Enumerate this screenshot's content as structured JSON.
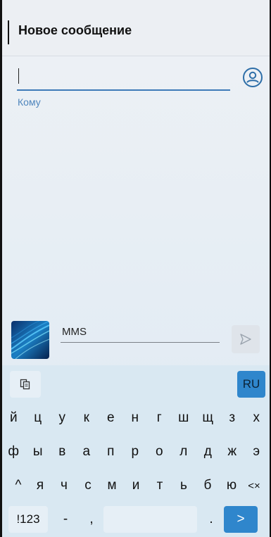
{
  "header": {
    "title": "Новое сообщение"
  },
  "recipient": {
    "label": "Кому",
    "value": ""
  },
  "compose": {
    "placeholder": "MMS"
  },
  "keyboard": {
    "lang": "RU",
    "row1": [
      "й",
      "ц",
      "у",
      "к",
      "е",
      "н",
      "г",
      "ш",
      "щ",
      "з",
      "х"
    ],
    "row2": [
      "ф",
      "ы",
      "в",
      "а",
      "п",
      "р",
      "о",
      "л",
      "д",
      "ж",
      "э"
    ],
    "row3": [
      "я",
      "ч",
      "с",
      "м",
      "и",
      "т",
      "ь",
      "б",
      "ю"
    ],
    "numbers": "!123",
    "dash": "-",
    "comma": ",",
    "period": ".",
    "shift_glyph": "^",
    "backspace_glyph": "<×",
    "enter_glyph": ">"
  },
  "colors": {
    "accent": "#2f86cc",
    "label_blue": "#4f86bd",
    "keyboard_bg": "#d9e8f2"
  }
}
